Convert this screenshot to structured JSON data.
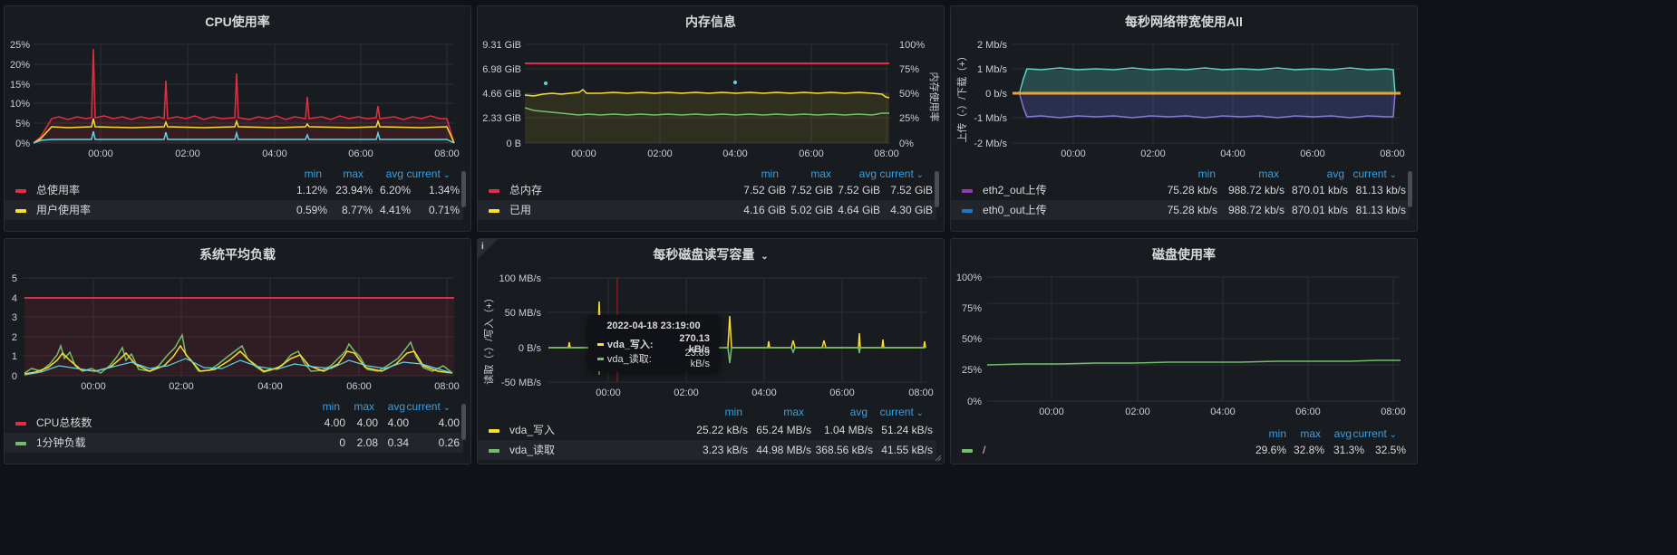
{
  "panels": {
    "cpu": {
      "title": "CPU使用率",
      "y_ticks": [
        "25%",
        "20%",
        "15%",
        "10%",
        "5%",
        "0%"
      ],
      "x_ticks": [
        "00:00",
        "02:00",
        "04:00",
        "06:00",
        "08:00"
      ],
      "legend_headers": [
        "min",
        "max",
        "avg",
        "current"
      ],
      "legend": [
        {
          "name": "总使用率",
          "color": "#e02f44",
          "min": "1.12%",
          "max": "23.94%",
          "avg": "6.20%",
          "current": "1.34%"
        },
        {
          "name": "用户使用率",
          "color": "#fade2a",
          "min": "0.59%",
          "max": "8.77%",
          "avg": "4.41%",
          "current": "0.71%"
        }
      ]
    },
    "memory": {
      "title": "内存信息",
      "y_ticks_left": [
        "9.31 GiB",
        "6.98 GiB",
        "4.66 GiB",
        "2.33 GiB",
        "0 B"
      ],
      "y_ticks_right": [
        "100%",
        "75%",
        "50%",
        "25%",
        "0%"
      ],
      "y_label_right": "内存使用率",
      "x_ticks": [
        "00:00",
        "02:00",
        "04:00",
        "06:00",
        "08:00"
      ],
      "legend_headers": [
        "min",
        "max",
        "avg",
        "current"
      ],
      "legend": [
        {
          "name": "总内存",
          "color": "#e02f44",
          "min": "7.52 GiB",
          "max": "7.52 GiB",
          "avg": "7.52 GiB",
          "current": "7.52 GiB"
        },
        {
          "name": "已用",
          "color": "#fade2a",
          "min": "4.16 GiB",
          "max": "5.02 GiB",
          "avg": "4.64 GiB",
          "current": "4.30 GiB"
        }
      ]
    },
    "network": {
      "title": "每秒网络带宽使用All",
      "y_ticks": [
        "2 Mb/s",
        "1 Mb/s",
        "0 b/s",
        "-1 Mb/s",
        "-2 Mb/s"
      ],
      "y_label": "上传（-）/下载（+）",
      "x_ticks": [
        "00:00",
        "02:00",
        "04:00",
        "06:00",
        "08:00"
      ],
      "legend_headers": [
        "min",
        "max",
        "avg",
        "current"
      ],
      "legend": [
        {
          "name": "eth2_out上传",
          "color": "#8f3bb8",
          "min": "75.28 kb/s",
          "max": "988.72 kb/s",
          "avg": "870.01 kb/s",
          "current": "81.13 kb/s"
        },
        {
          "name": "eth0_out上传",
          "color": "#1f78c1",
          "min": "75.28 kb/s",
          "max": "988.72 kb/s",
          "avg": "870.01 kb/s",
          "current": "81.13 kb/s"
        }
      ]
    },
    "load": {
      "title": "系统平均负载",
      "y_ticks": [
        "5",
        "4",
        "3",
        "2",
        "1",
        "0"
      ],
      "x_ticks": [
        "00:00",
        "02:00",
        "04:00",
        "06:00",
        "08:00"
      ],
      "legend_headers": [
        "min",
        "max",
        "avg",
        "current"
      ],
      "legend": [
        {
          "name": "CPU总核数",
          "color": "#e02f44",
          "min": "4.00",
          "max": "4.00",
          "avg": "4.00",
          "current": "4.00"
        },
        {
          "name": "1分钟负载",
          "color": "#73bf69",
          "min": "0",
          "max": "2.08",
          "avg": "0.34",
          "current": "0.26"
        }
      ]
    },
    "disk_io": {
      "title": "每秒磁盘读写容量",
      "y_ticks": [
        "100 MB/s",
        "50 MB/s",
        "0 B/s",
        "-50 MB/s"
      ],
      "y_label": "读取（-）/写入（+）",
      "x_ticks": [
        "00:00",
        "02:00",
        "04:00",
        "06:00",
        "08:00"
      ],
      "legend_headers": [
        "min",
        "max",
        "avg",
        "current"
      ],
      "legend": [
        {
          "name": "vda_写入",
          "color": "#fade2a",
          "min": "25.22 kB/s",
          "max": "65.24 MB/s",
          "avg": "1.04 MB/s",
          "current": "51.24 kB/s"
        },
        {
          "name": "vda_读取",
          "color": "#73bf69",
          "min": "3.23 kB/s",
          "max": "44.98 MB/s",
          "avg": "368.56 kB/s",
          "current": "41.55 kB/s"
        }
      ],
      "tooltip": {
        "time": "2022-04-18 23:19:00",
        "rows": [
          {
            "name": "vda_写入:",
            "value": "270.13 kB/s",
            "color": "#fade2a"
          },
          {
            "name": "vda_读取:",
            "value": "23.89 kB/s",
            "color": "#73bf69"
          }
        ]
      }
    },
    "disk_usage": {
      "title": "磁盘使用率",
      "y_ticks": [
        "100%",
        "75%",
        "50%",
        "25%",
        "0%"
      ],
      "x_ticks": [
        "00:00",
        "02:00",
        "04:00",
        "06:00",
        "08:00"
      ],
      "legend_headers": [
        "min",
        "max",
        "avg",
        "current"
      ],
      "legend": [
        {
          "name": "/",
          "color": "#73bf69",
          "min": "29.6%",
          "max": "32.8%",
          "avg": "31.3%",
          "current": "32.5%"
        }
      ]
    }
  }
}
